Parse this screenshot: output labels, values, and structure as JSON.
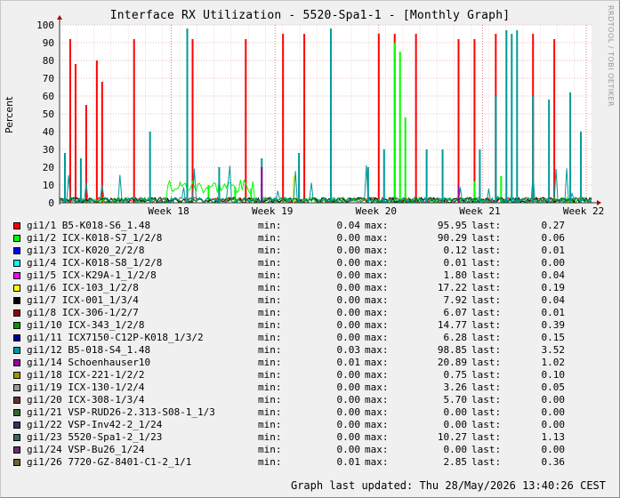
{
  "title": "Interface RX Utilization - 5520-Spa1-1 - [Monthly Graph]",
  "watermark": "RRDTOOL / TOBI OETIKER",
  "ylabel": "Percent",
  "updated": "Graph last updated: Thu 28/May/2026 13:40:26 CEST",
  "legend_keys": {
    "min": "min:",
    "max": "max:",
    "last": "last:"
  },
  "chart_data": {
    "type": "line",
    "title": "Interface RX Utilization - 5520-Spa1-1 - [Monthly Graph]",
    "ylabel": "Percent",
    "ylim": [
      0,
      100
    ],
    "yticks": [
      0,
      10,
      20,
      30,
      40,
      50,
      60,
      70,
      80,
      90,
      100
    ],
    "x_week_labels": [
      "Week 18",
      "Week 19",
      "Week 20",
      "Week 21",
      "Week 22"
    ],
    "grid": true,
    "legend_position": "bottom",
    "series": [
      {
        "name": "gi1/1 B5-K018-S6_1.48",
        "color": "#ff0000",
        "min": "0.04",
        "max": "95.95",
        "last": "0.27",
        "spikes": [
          [
            0.02,
            92
          ],
          [
            0.03,
            78
          ],
          [
            0.05,
            55
          ],
          [
            0.07,
            80
          ],
          [
            0.08,
            68
          ],
          [
            0.14,
            92
          ],
          [
            0.25,
            92
          ],
          [
            0.35,
            92
          ],
          [
            0.42,
            95
          ],
          [
            0.46,
            95
          ],
          [
            0.6,
            95
          ],
          [
            0.63,
            95
          ],
          [
            0.67,
            95
          ],
          [
            0.75,
            92
          ],
          [
            0.78,
            92
          ],
          [
            0.82,
            95
          ],
          [
            0.89,
            95
          ],
          [
            0.93,
            92
          ]
        ]
      },
      {
        "name": "gi1/2 ICX-K018-S7_1/2/8",
        "color": "#00ff00",
        "min": "0.00",
        "max": "90.29",
        "last": "0.06",
        "spikes": [
          [
            0.28,
            10
          ],
          [
            0.3,
            12
          ],
          [
            0.33,
            9
          ],
          [
            0.36,
            8
          ],
          [
            0.63,
            90
          ],
          [
            0.64,
            85
          ],
          [
            0.65,
            48
          ],
          [
            0.78,
            12
          ],
          [
            0.83,
            15
          ]
        ]
      },
      {
        "name": "gi1/3 ICX-K020_2/2/8",
        "color": "#0000ff",
        "min": "0.00",
        "max": "0.12",
        "last": "0.01",
        "spikes": []
      },
      {
        "name": "gi1/4 ICX-K018-S8_1/2/8",
        "color": "#00ffff",
        "min": "0.00",
        "max": "0.01",
        "last": "0.00",
        "spikes": []
      },
      {
        "name": "gi1/5 ICX-K29A-1_1/2/8",
        "color": "#ff00ff",
        "min": "0.00",
        "max": "1.80",
        "last": "0.04",
        "spikes": []
      },
      {
        "name": "gi1/6 ICX-103_1/2/8",
        "color": "#ffff00",
        "min": "0.00",
        "max": "17.22",
        "last": "0.19",
        "spikes": [
          [
            0.44,
            15
          ]
        ]
      },
      {
        "name": "gi1/7 ICX-001_1/3/4",
        "color": "#000000",
        "min": "0.00",
        "max": "7.92",
        "last": "0.04",
        "spikes": []
      },
      {
        "name": "gi1/8 ICX-306-1/2/7",
        "color": "#990000",
        "min": "0.00",
        "max": "6.07",
        "last": "0.01",
        "spikes": []
      },
      {
        "name": "gi1/10 ICX-343_1/2/8",
        "color": "#009900",
        "min": "0.00",
        "max": "14.77",
        "last": "0.39",
        "spikes": []
      },
      {
        "name": "gi1/11 ICX7150-C12P-K018_1/3/2",
        "color": "#000099",
        "min": "0.00",
        "max": "6.28",
        "last": "0.15",
        "spikes": []
      },
      {
        "name": "gi1/12 B5-018-S4_1.48",
        "color": "#009999",
        "min": "0.03",
        "max": "98.85",
        "last": "3.52",
        "spikes": [
          [
            0.01,
            28
          ],
          [
            0.04,
            25
          ],
          [
            0.17,
            40
          ],
          [
            0.24,
            98
          ],
          [
            0.3,
            20
          ],
          [
            0.38,
            25
          ],
          [
            0.45,
            28
          ],
          [
            0.51,
            98
          ],
          [
            0.58,
            20
          ],
          [
            0.61,
            30
          ],
          [
            0.69,
            30
          ],
          [
            0.72,
            30
          ],
          [
            0.79,
            30
          ],
          [
            0.82,
            60
          ],
          [
            0.84,
            97
          ],
          [
            0.85,
            95
          ],
          [
            0.86,
            97
          ],
          [
            0.89,
            60
          ],
          [
            0.92,
            58
          ],
          [
            0.96,
            62
          ],
          [
            0.98,
            40
          ]
        ]
      },
      {
        "name": "gi1/14 Schoenhauser10",
        "color": "#990099",
        "min": "0.01",
        "max": "20.89",
        "last": "1.02",
        "spikes": [
          [
            0.38,
            20
          ],
          [
            0.75,
            10
          ]
        ]
      },
      {
        "name": "gi1/18 ICX-221-1/2/2",
        "color": "#999900",
        "min": "0.00",
        "max": "0.75",
        "last": "0.10",
        "spikes": []
      },
      {
        "name": "gi1/19 ICX-130-1/2/4",
        "color": "#999999",
        "min": "0.00",
        "max": "3.26",
        "last": "0.05",
        "spikes": []
      },
      {
        "name": "gi1/20 ICX-308-1/3/4",
        "color": "#663333",
        "min": "0.00",
        "max": "5.70",
        "last": "0.00",
        "spikes": []
      },
      {
        "name": "gi1/21 VSP-RUD26-2.313-S08-1_1/3",
        "color": "#336633",
        "min": "0.00",
        "max": "0.00",
        "last": "0.00",
        "spikes": []
      },
      {
        "name": "gi1/22 VSP-Inv42-2_1/24",
        "color": "#333366",
        "min": "0.00",
        "max": "0.00",
        "last": "0.00",
        "spikes": []
      },
      {
        "name": "gi1/23 5520-Spa1-2_1/23",
        "color": "#336666",
        "min": "0.00",
        "max": "10.27",
        "last": "1.13",
        "spikes": []
      },
      {
        "name": "gi1/24 VSP-Bu26_1/24",
        "color": "#663366",
        "min": "0.00",
        "max": "0.00",
        "last": "0.00",
        "spikes": []
      },
      {
        "name": "gi1/26 7720-GZ-8401-C1-2_1/1",
        "color": "#666633",
        "min": "0.01",
        "max": "2.85",
        "last": "0.36",
        "spikes": []
      }
    ]
  }
}
